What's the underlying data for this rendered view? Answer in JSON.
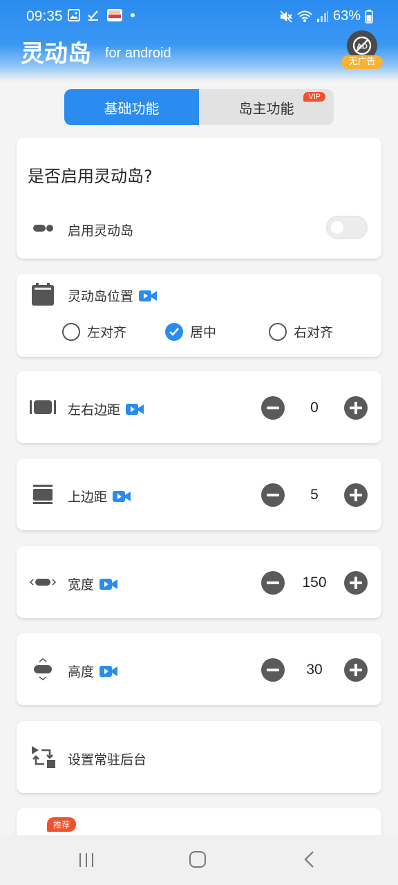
{
  "status": {
    "time": "09:35",
    "battery": "63%"
  },
  "header": {
    "title": "灵动岛",
    "subtitle": "for android",
    "noad_label": "无广告",
    "noad_icon_text": "AD"
  },
  "tabs": [
    {
      "label": "基础功能",
      "active": true
    },
    {
      "label": "岛主功能",
      "active": false,
      "badge": "VIP"
    }
  ],
  "enable_card": {
    "question": "是否启用灵动岛?",
    "label": "启用灵动岛",
    "enabled": false
  },
  "position_card": {
    "label": "灵动岛位置",
    "options": [
      "左对齐",
      "居中",
      "右对齐"
    ],
    "selected": "居中"
  },
  "steppers": [
    {
      "label": "左右边距",
      "value": "0"
    },
    {
      "label": "上边距",
      "value": "5"
    },
    {
      "label": "宽度",
      "value": "150"
    },
    {
      "label": "高度",
      "value": "30"
    }
  ],
  "resident_card": {
    "label": "设置常驻后台"
  },
  "partial_card": {
    "badge": "推荐"
  },
  "colors": {
    "accent": "#2b8cf0",
    "vip": "#f0522e",
    "noad": "#f7b233"
  }
}
